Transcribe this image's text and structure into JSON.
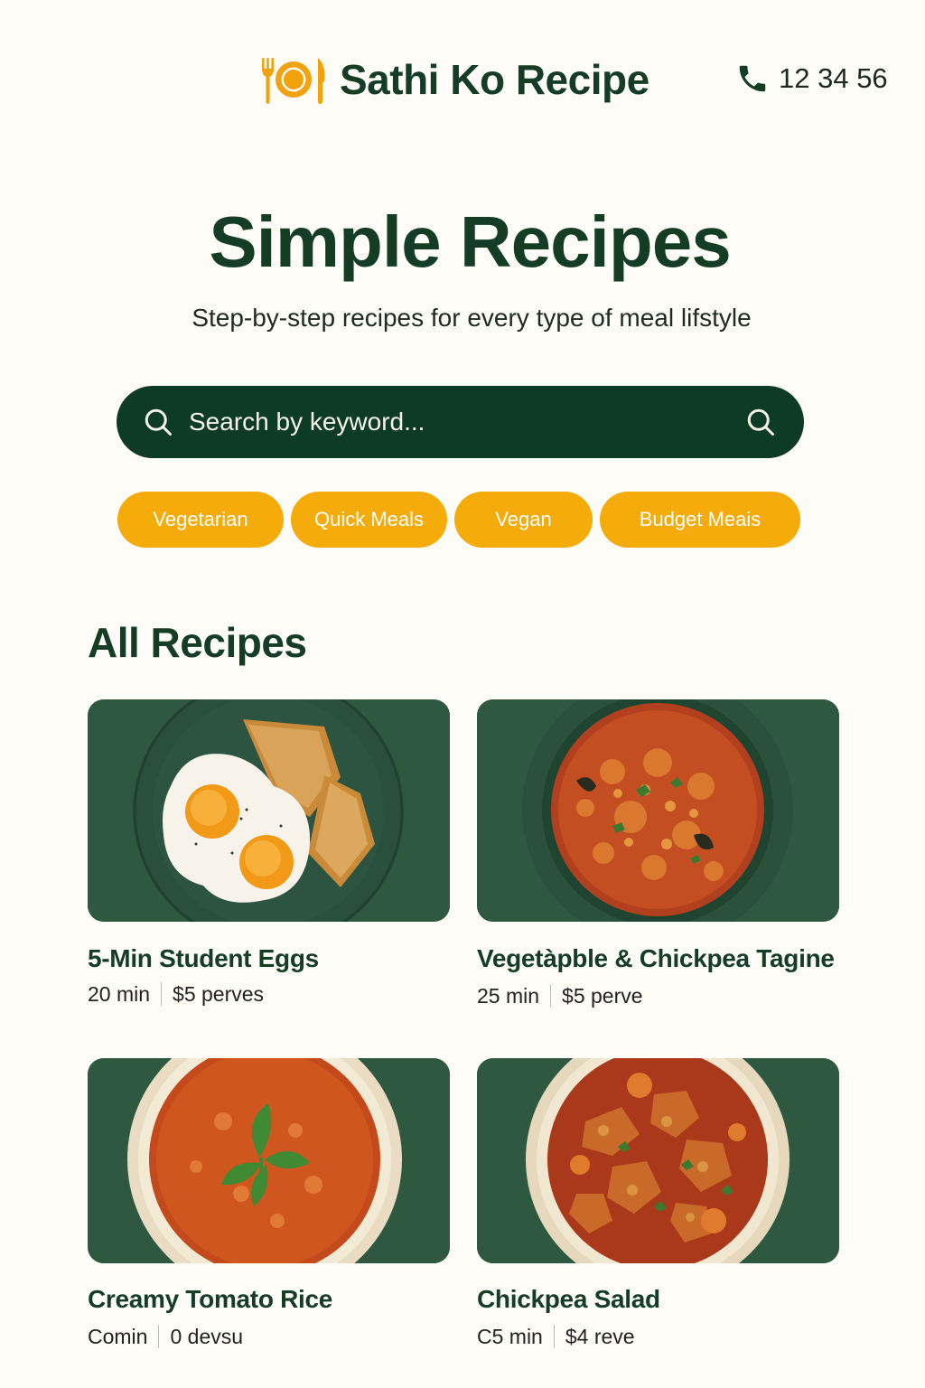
{
  "header": {
    "brand_name": "Sathi Ko Recipe",
    "logo_icon": "plate-cutlery-icon",
    "phone_icon": "phone-icon",
    "phone_number": "12 34 56"
  },
  "hero": {
    "title": "Simple Recipes",
    "subtitle": "Step-by-step recipes for every type of meal lifstyle"
  },
  "search": {
    "placeholder": "Search by keyword...",
    "value": "",
    "leading_icon": "search-icon",
    "submit_icon": "search-icon"
  },
  "filters": [
    {
      "label": "Vegetarian"
    },
    {
      "label": "Quick Meals"
    },
    {
      "label": "Vegan"
    },
    {
      "label": "Budget Meais"
    }
  ],
  "section": {
    "title": "All Recipes"
  },
  "recipes": [
    {
      "title": "5-Min Student Eggs",
      "time": "20 min",
      "cost": "$5 perves",
      "image": "fried-eggs-toast-image"
    },
    {
      "title": "Vegetàpble & Chickpea Tagine",
      "time": "25 min",
      "cost": "$5 perve",
      "image": "vegetable-chickpea-tagine-image"
    },
    {
      "title": "Creamy Tomato Rice",
      "time": "Comin",
      "cost": "0 devsu",
      "image": "tomato-rice-soup-image"
    },
    {
      "title": "Chickpea Salad",
      "time": "C5 min",
      "cost": "$4 reve",
      "image": "chickpea-chicken-curry-image"
    }
  ],
  "colors": {
    "brand_green": "#153d26",
    "search_bg": "#0e3b23",
    "chip_yellow": "#f5ac0a",
    "logo_orange": "#f2a20d",
    "page_bg": "#fdfcf6",
    "card_bg": "#2f5840"
  }
}
